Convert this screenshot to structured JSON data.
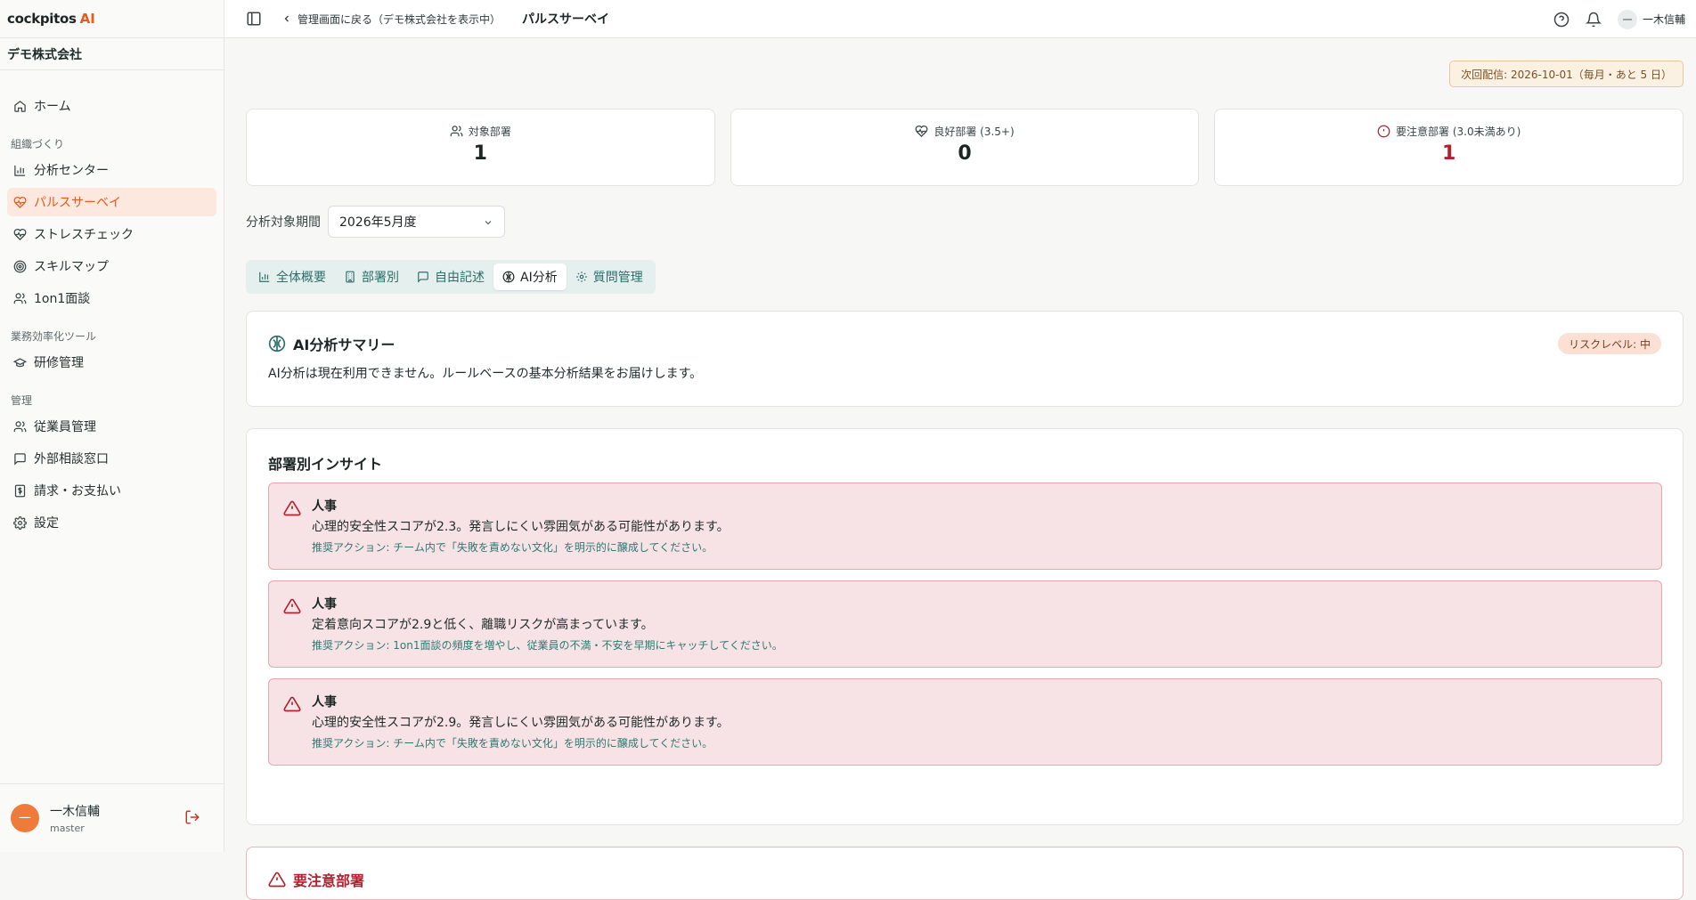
{
  "brand": {
    "name": "cockpitos",
    "ai": "AI"
  },
  "company": "デモ株式会社",
  "sidebar": {
    "home": "ホーム",
    "section_org": "組織づくり",
    "org_items": [
      "分析センター",
      "パルスサーベイ",
      "ストレスチェック",
      "スキルマップ",
      "1on1面談"
    ],
    "section_tools": "業務効率化ツール",
    "tool_items": [
      "研修管理"
    ],
    "section_admin": "管理",
    "admin_items": [
      "従業員管理",
      "外部相談窓口",
      "請求・お支払い",
      "設定"
    ],
    "active_item": "パルスサーベイ"
  },
  "user": {
    "initial": "一",
    "name": "一木信輔",
    "role": "master"
  },
  "header": {
    "back_label": "管理画面に戻る（デモ株式会社を表示中）",
    "title": "パルスサーベイ",
    "user_initial": "一",
    "user_name": "一木信輔"
  },
  "next_delivery": "次回配信: 2026-10-01（毎月・あと 5 日）",
  "stats": [
    {
      "label": "対象部署",
      "value": "1",
      "icon": "users-icon"
    },
    {
      "label": "良好部署 (3.5+)",
      "value": "0",
      "icon": "heart-pulse-icon"
    },
    {
      "label": "要注意部署 (3.0未満あり)",
      "value": "1",
      "icon": "alert-circle-icon"
    }
  ],
  "period": {
    "label": "分析対象期間",
    "value": "2026年5月度"
  },
  "tabs": [
    "全体概要",
    "部署別",
    "自由記述",
    "AI分析",
    "質問管理"
  ],
  "active_tab": "AI分析",
  "summary": {
    "title": "AI分析サマリー",
    "text": "AI分析は現在利用できません。ルールベースの基本分析結果をお届けします。",
    "risk": "リスクレベル: 中"
  },
  "insights": {
    "title": "部署別インサイト",
    "items": [
      {
        "dept": "人事",
        "message": "心理的安全性スコアが2.3。発言しにくい雰囲気がある可能性があります。",
        "action": "推奨アクション: チーム内で「失敗を責めない文化」を明示的に醸成してください。"
      },
      {
        "dept": "人事",
        "message": "定着意向スコアが2.9と低く、離職リスクが高まっています。",
        "action": "推奨アクション: 1on1面談の頻度を増やし、従業員の不満・不安を早期にキャッチしてください。"
      },
      {
        "dept": "人事",
        "message": "心理的安全性スコアが2.9。発言しにくい雰囲気がある可能性があります。",
        "action": "推奨アクション: チーム内で「失敗を責めない文化」を明示的に醸成してください。"
      }
    ]
  },
  "attention": {
    "title": "要注意部署"
  },
  "colors": {
    "accent": "#e85a1f",
    "teal": "#2c6e6a",
    "danger": "#b3202f",
    "alert_bg": "#f7e3e5"
  }
}
